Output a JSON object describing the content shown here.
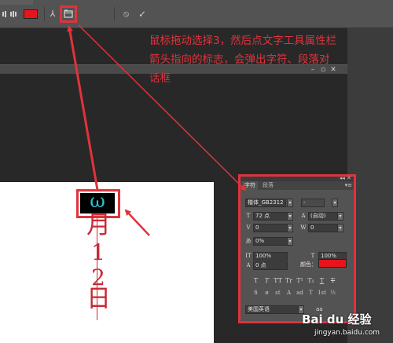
{
  "options_bar": {
    "warp_glyph": "⅄",
    "cancel_glyph": "⦸",
    "commit_glyph": "✓",
    "text_color": "#e8141c"
  },
  "document": {
    "cursor_glyph": "ω",
    "vertical_text": [
      "月",
      "1",
      "2",
      "日"
    ]
  },
  "char_panel": {
    "tabs": [
      "字符",
      "段落"
    ],
    "menu_glyph": "▾≡",
    "font_family": "楷体_GB2312",
    "font_style": "-",
    "font_size": "72 点",
    "leading": "(自动)",
    "kerning": "0",
    "tracking": "0",
    "baseline_scale": "0%",
    "vertical_scale": "100%",
    "horizontal_scale": "100%",
    "baseline_shift": "0 点",
    "color_label": "颜色：",
    "color": "#e8141c",
    "style_buttons": [
      "T",
      "T",
      "TT",
      "Tr",
      "T¹",
      "T₁",
      "T",
      "T"
    ],
    "feature_buttons": [
      "fi",
      "ø",
      "st",
      "A",
      "ad",
      "T",
      "1st",
      "½"
    ],
    "language": "美国英语",
    "antialias_label": "aa"
  },
  "annotation": {
    "lines": [
      "鼠标拖动选择3，然后点文字工具属性栏",
      "箭头指向的标志，会弹出字符、段落对",
      "话框"
    ],
    "color": "#e0333c"
  },
  "watermark": {
    "brand": "Bai du 经验",
    "url": "jingyan.baidu.com"
  }
}
